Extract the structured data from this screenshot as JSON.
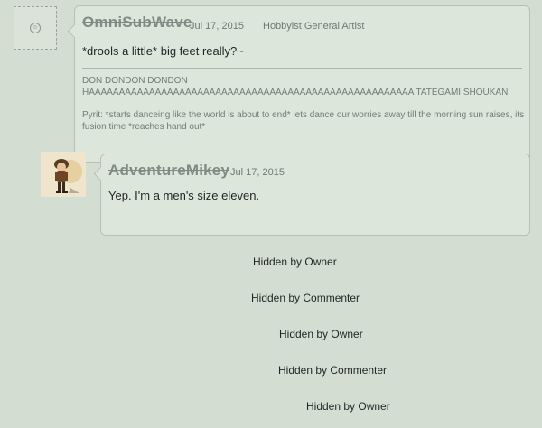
{
  "comments": [
    {
      "username": "OmniSubWave",
      "date": "Jul 17, 2015",
      "user_type": "Hobbyist General Artist",
      "body": "*drools a little* big feet really?~",
      "signature": [
        "DON DONDON DONDON",
        "HAAAAAAAAAAAAAAAAAAAAAAAAAAAAAAAAAAAAAAAAAAAAAAAAAAAAAA TATEGAMI SHOUKAN",
        "Pyrit: *starts danceing like the world is about to end* lets dance our worries away till the morning sun raises, its fusion time *reaches hand out*"
      ]
    },
    {
      "username": "AdventureMikey",
      "date": "Jul 17, 2015",
      "body": "Yep. I'm a men's size eleven."
    }
  ],
  "hidden": [
    "Hidden by Owner",
    "Hidden by Commenter",
    "Hidden by Owner",
    "Hidden by Commenter",
    "Hidden by Owner"
  ]
}
